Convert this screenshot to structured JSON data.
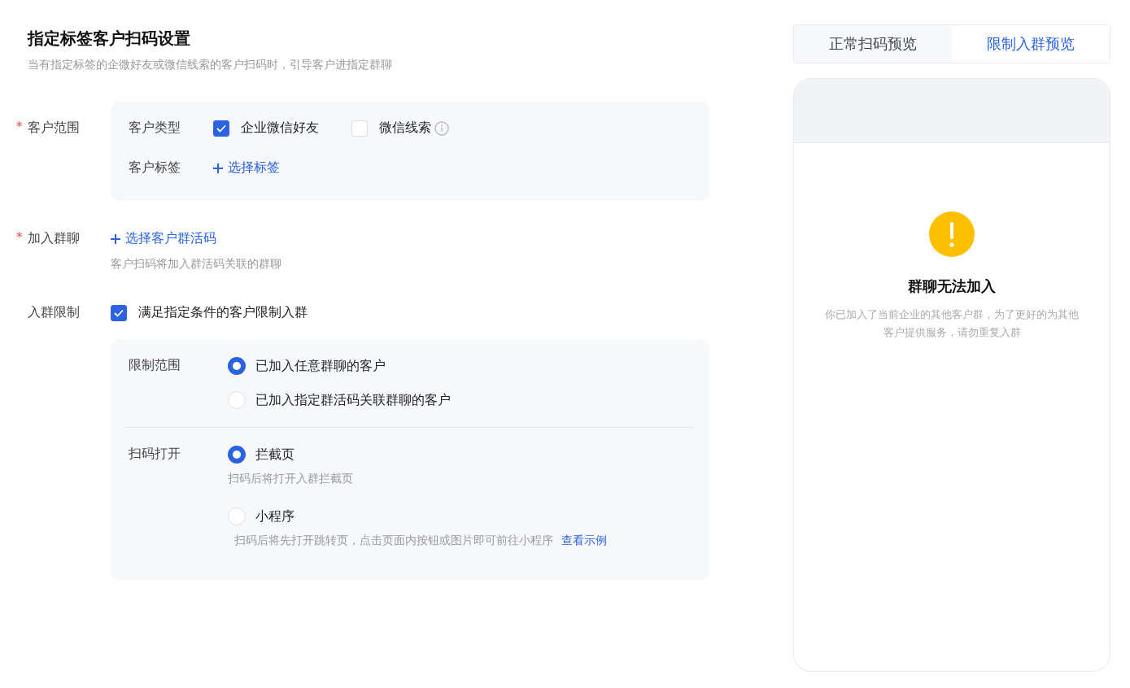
{
  "header": {
    "title": "指定标签客户扫码设置",
    "description": "当有指定标签的企微好友或微信线索的客户扫码时，引导客户进指定群聊"
  },
  "customer_scope": {
    "label": "客户范围",
    "required_mark": "*",
    "type_label": "客户类型",
    "types": [
      {
        "label": "企业微信好友",
        "checked": true,
        "info": false
      },
      {
        "label": "微信线索",
        "checked": false,
        "info": true
      }
    ],
    "tag_label": "客户标签",
    "tag_action": "选择标签"
  },
  "join_group": {
    "label": "加入群聊",
    "required_mark": "*",
    "action": "选择客户群活码",
    "hint": "客户扫码将加入群活码关联的群聊"
  },
  "limit": {
    "label": "入群限制",
    "checkbox": {
      "label": "满足指定条件的客户限制入群",
      "checked": true
    },
    "range": {
      "label": "限制范围",
      "options": [
        {
          "label": "已加入任意群聊的客户",
          "selected": true
        },
        {
          "label": "已加入指定群活码关联群聊的客户",
          "selected": false
        }
      ]
    },
    "open": {
      "label": "扫码打开",
      "options": [
        {
          "label": "拦截页",
          "selected": true,
          "hint": "扫码后将打开入群拦截页"
        },
        {
          "label": "小程序",
          "selected": false,
          "hint": "扫码后将先打开跳转页，点击页面内按钮或图片即可前往小程序",
          "link": "查看示例"
        }
      ]
    }
  },
  "preview": {
    "tabs": [
      {
        "label": "正常扫码预览",
        "selected": false
      },
      {
        "label": "限制入群预览",
        "selected": true
      }
    ],
    "title": "群聊无法加入",
    "message": "你已加入了当前企业的其他客户群，为了更好的为其他客户提供服务，请勿重复入群"
  }
}
